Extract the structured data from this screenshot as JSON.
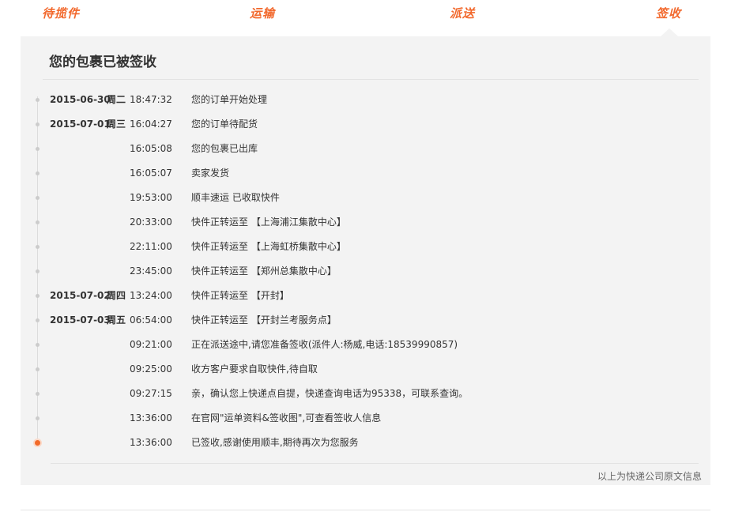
{
  "steps": [
    "待揽件",
    "运输",
    "派送",
    "签收"
  ],
  "panel": {
    "title": "您的包裹已被签收",
    "source_note": "以上为快递公司原文信息"
  },
  "timeline": [
    {
      "date": "2015-06-30",
      "weekday": "周二",
      "time": "18:47:32",
      "desc": "您的订单开始处理"
    },
    {
      "date": "2015-07-01",
      "weekday": "周三",
      "time": "16:04:27",
      "desc": "您的订单待配货"
    },
    {
      "date": "",
      "weekday": "",
      "time": "16:05:08",
      "desc": "您的包裹已出库"
    },
    {
      "date": "",
      "weekday": "",
      "time": "16:05:07",
      "desc": "卖家发货"
    },
    {
      "date": "",
      "weekday": "",
      "time": "19:53:00",
      "desc": "顺丰速运 已收取快件"
    },
    {
      "date": "",
      "weekday": "",
      "time": "20:33:00",
      "desc": "快件正转运至 【上海浦江集散中心】"
    },
    {
      "date": "",
      "weekday": "",
      "time": "22:11:00",
      "desc": "快件正转运至 【上海虹桥集散中心】"
    },
    {
      "date": "",
      "weekday": "",
      "time": "23:45:00",
      "desc": "快件正转运至 【郑州总集散中心】"
    },
    {
      "date": "2015-07-02",
      "weekday": "周四",
      "time": "13:24:00",
      "desc": "快件正转运至 【开封】"
    },
    {
      "date": "2015-07-03",
      "weekday": "周五",
      "time": "06:54:00",
      "desc": "快件正转运至 【开封兰考服务点】"
    },
    {
      "date": "",
      "weekday": "",
      "time": "09:21:00",
      "desc": "正在派送途中,请您准备签收(派件人:杨威,电话:18539990857)"
    },
    {
      "date": "",
      "weekday": "",
      "time": "09:25:00",
      "desc": "收方客户要求自取快件,待自取"
    },
    {
      "date": "",
      "weekday": "",
      "time": "09:27:15",
      "desc": "亲，确认您上快递点自提，快递查询电话为95338，可联系查询。"
    },
    {
      "date": "",
      "weekday": "",
      "time": "13:36:00",
      "desc": "在官网\"运单资料&签收图\",可查看签收人信息"
    },
    {
      "date": "",
      "weekday": "",
      "time": "13:36:00",
      "desc": "已签收,感谢使用顺丰,期待再次为您服务"
    }
  ],
  "colors": {
    "accent": "#f2682c",
    "panel_bg": "#f3f3f3",
    "dot": "#cccccc"
  }
}
